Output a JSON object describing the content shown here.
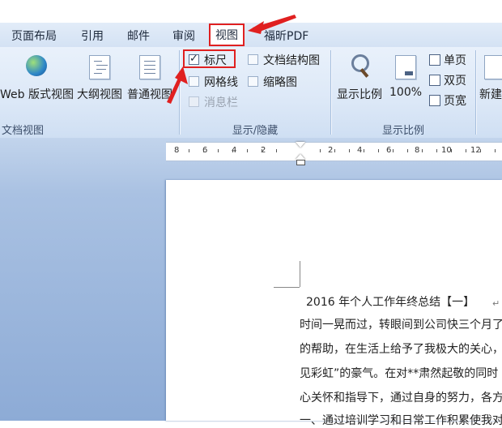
{
  "tabs": [
    {
      "label": "页面布局",
      "active": false
    },
    {
      "label": "引用",
      "active": false
    },
    {
      "label": "邮件",
      "active": false
    },
    {
      "label": "审阅",
      "active": false
    },
    {
      "label": "视图",
      "active": true
    },
    {
      "label": "福昕PDF",
      "active": false
    }
  ],
  "ribbon": {
    "doc_views": {
      "web_label": "Web 版式视图",
      "outline_label": "大纲视图",
      "draft_label": "普通视图",
      "group_label": "文档视图"
    },
    "show_hide": {
      "ruler": {
        "label": "标尺",
        "checked": true
      },
      "gridlines": {
        "label": "网格线",
        "checked": false
      },
      "message_bar": {
        "label": "消息栏",
        "checked": false
      },
      "doc_map": {
        "label": "文档结构图",
        "checked": false
      },
      "thumbnails": {
        "label": "缩略图",
        "checked": false
      },
      "group_label": "显示/隐藏"
    },
    "zoom": {
      "zoom_label": "显示比例",
      "zoom_100_label": "100%",
      "one_page_label": "单页",
      "two_pages_label": "双页",
      "page_width_label": "页宽",
      "group_label": "显示比例"
    },
    "window": {
      "new_window_label": "新建"
    }
  },
  "ruler": {
    "left_numbers": [
      "8",
      "6",
      "4",
      "2"
    ],
    "right_numbers": [
      "2",
      "4",
      "6",
      "8",
      "10",
      "12"
    ]
  },
  "document": {
    "lines": [
      "2016 年个人工作年终总结【一】",
      "时间一晃而过，转眼间到公司快三个月了",
      "的帮助，在生活上给予了我极大的关心，",
      "见彩虹”的豪气。在对**肃然起敬的同时",
      "心关怀和指导下，通过自身的努力，各方",
      "一、通过培训学习和日常工作积累使我对"
    ],
    "paragraph_mark": "↵"
  },
  "colors": {
    "annotation": "#e02020",
    "ribbon_bg": "#dce8f7",
    "doc_bg": "#a9c1e2"
  }
}
